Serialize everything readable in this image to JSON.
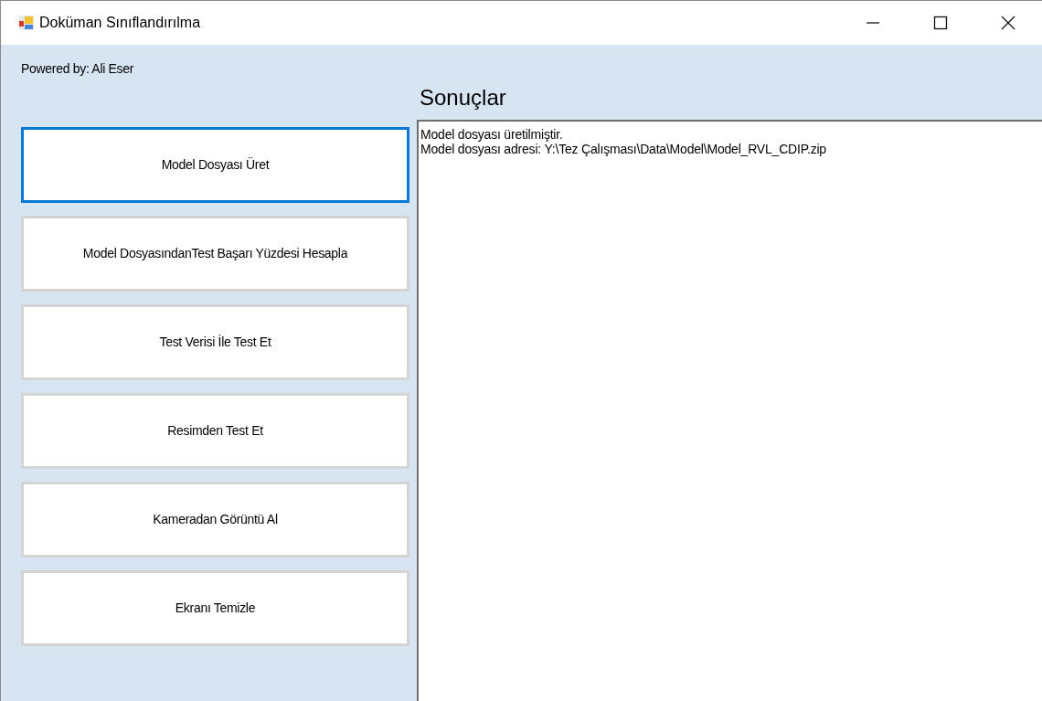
{
  "window": {
    "title": "Doküman Sınıflandırılma"
  },
  "credit": "Powered by: Ali Eser",
  "buttons": [
    {
      "label": "Model Dosyası Üret",
      "focused": true
    },
    {
      "label": "Model DosyasındanTest Başarı Yüzdesi Hesapla",
      "focused": false
    },
    {
      "label": "Test Verisi İle Test Et",
      "focused": false
    },
    {
      "label": "Resimden Test Et",
      "focused": false
    },
    {
      "label": "Kameradan Görüntü Al",
      "focused": false
    },
    {
      "label": "Ekranı Temizle",
      "focused": false
    }
  ],
  "results": {
    "title": "Sonuçlar",
    "lines": [
      "Model dosyası üretilmiştir.",
      "Model dosyası adresi: Y:\\Tez Çalışması\\Data\\Model\\Model_RVL_CDIP.zip"
    ]
  }
}
